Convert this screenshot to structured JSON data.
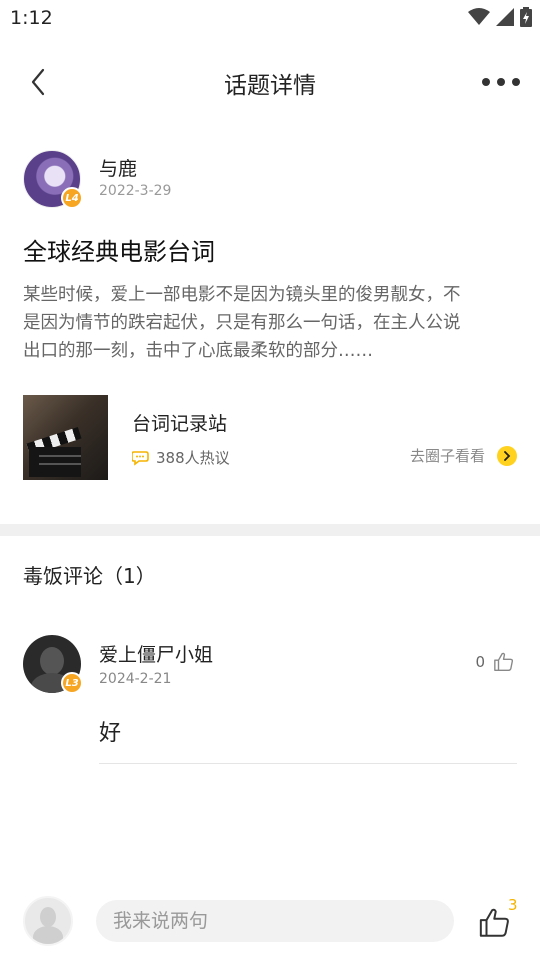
{
  "status_bar": {
    "time": "1:12"
  },
  "nav": {
    "title": "话题详情"
  },
  "author": {
    "name": "与鹿",
    "date": "2022-3-29",
    "level": "L4"
  },
  "topic": {
    "title": "全球经典电影台词",
    "body_lines": [
      "某些时候，爱上一部电影不是因为镜头里的俊男靓女，不",
      "是因为情节的跌宕起伏，只是有那么一句话，在主人公说",
      "出口的那一刻，击中了心底最柔软的部分……"
    ]
  },
  "circle": {
    "name": "台词记录站",
    "stat": "388人热议",
    "go_label": "去圈子看看"
  },
  "comments": {
    "heading": "毒饭评论（1）",
    "items": [
      {
        "name": "爱上僵尸小姐",
        "date": "2024-2-21",
        "level": "L3",
        "likes": "0",
        "text": "好"
      }
    ]
  },
  "bottom_bar": {
    "input_placeholder": "我来说两句",
    "like_count": "3"
  },
  "colors": {
    "accent_yellow": "#ffd21f",
    "badge_orange": "#f6a623",
    "like_count_yellow": "#f5b400"
  },
  "icons": [
    "wifi-icon",
    "signal-icon",
    "battery-icon",
    "back-arrow-icon",
    "more-icon",
    "chat-bubble-icon",
    "chevron-right-icon",
    "thumbs-up-icon"
  ]
}
